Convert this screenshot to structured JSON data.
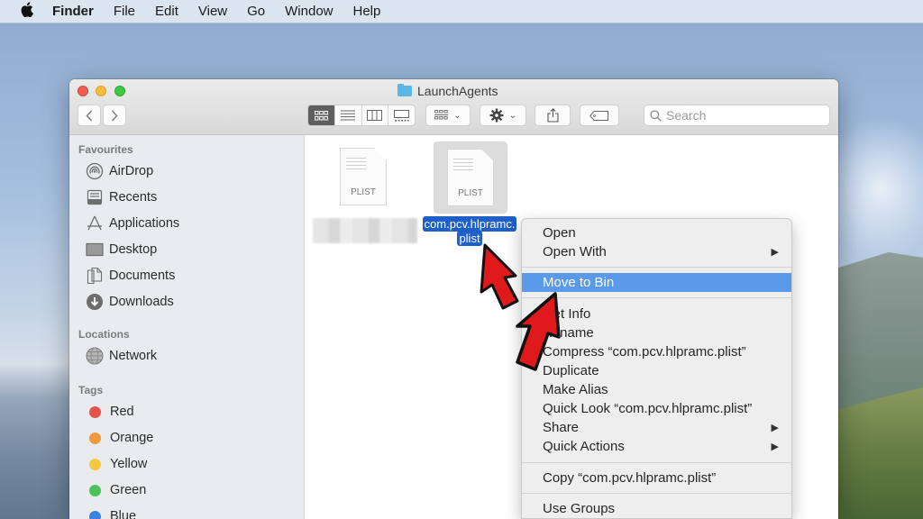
{
  "menubar": {
    "apple_icon": "apple-logo",
    "items": [
      "Finder",
      "File",
      "Edit",
      "View",
      "Go",
      "Window",
      "Help"
    ]
  },
  "window": {
    "title": "LaunchAgents",
    "toolbar": {
      "back_icon": "chevron-left",
      "forward_icon": "chevron-right",
      "view_modes": [
        "icon-view",
        "list-view",
        "column-view",
        "gallery-view"
      ],
      "active_view": "icon-view",
      "search_placeholder": "Search",
      "search_value": ""
    }
  },
  "sidebar": {
    "favourites_header": "Favourites",
    "favourites": [
      {
        "label": "AirDrop",
        "icon": "airdrop-icon"
      },
      {
        "label": "Recents",
        "icon": "recents-icon"
      },
      {
        "label": "Applications",
        "icon": "applications-icon"
      },
      {
        "label": "Desktop",
        "icon": "desktop-icon"
      },
      {
        "label": "Documents",
        "icon": "documents-icon"
      },
      {
        "label": "Downloads",
        "icon": "downloads-icon"
      }
    ],
    "locations_header": "Locations",
    "locations": [
      {
        "label": "Network",
        "icon": "network-icon"
      }
    ],
    "tags_header": "Tags",
    "tags": [
      {
        "label": "Red",
        "color": "#e5534b"
      },
      {
        "label": "Orange",
        "color": "#f09a3e"
      },
      {
        "label": "Yellow",
        "color": "#f5c842"
      },
      {
        "label": "Green",
        "color": "#4cc25a"
      },
      {
        "label": "Blue",
        "color": "#3b82e0"
      }
    ]
  },
  "files": [
    {
      "name": "",
      "type_label": "PLIST",
      "selected": false,
      "name_obscured": true
    },
    {
      "name_line1": "com.pcv.hlpramc.",
      "name_line2": "plist",
      "type_label": "PLIST",
      "selected": true
    }
  ],
  "context_menu": {
    "items": [
      {
        "label": "Open"
      },
      {
        "label": "Open With",
        "submenu": true
      },
      {
        "label": "Move to Bin",
        "highlighted": true
      },
      {
        "label": "Get Info"
      },
      {
        "label": "Rename"
      },
      {
        "label": "Compress “com.pcv.hlpramc.plist”"
      },
      {
        "label": "Duplicate"
      },
      {
        "label": "Make Alias"
      },
      {
        "label": "Quick Look “com.pcv.hlpramc.plist”"
      },
      {
        "label": "Share",
        "submenu": true
      },
      {
        "label": "Quick Actions",
        "submenu": true
      },
      {
        "label": "Copy “com.pcv.hlpramc.plist”"
      },
      {
        "label": "Use Groups"
      }
    ],
    "submenu_glyph": "▶"
  },
  "annotations": {
    "arrow_color": "#e0191c",
    "arrows": [
      "pointing-to-selected-file",
      "pointing-to-move-to-bin"
    ]
  }
}
